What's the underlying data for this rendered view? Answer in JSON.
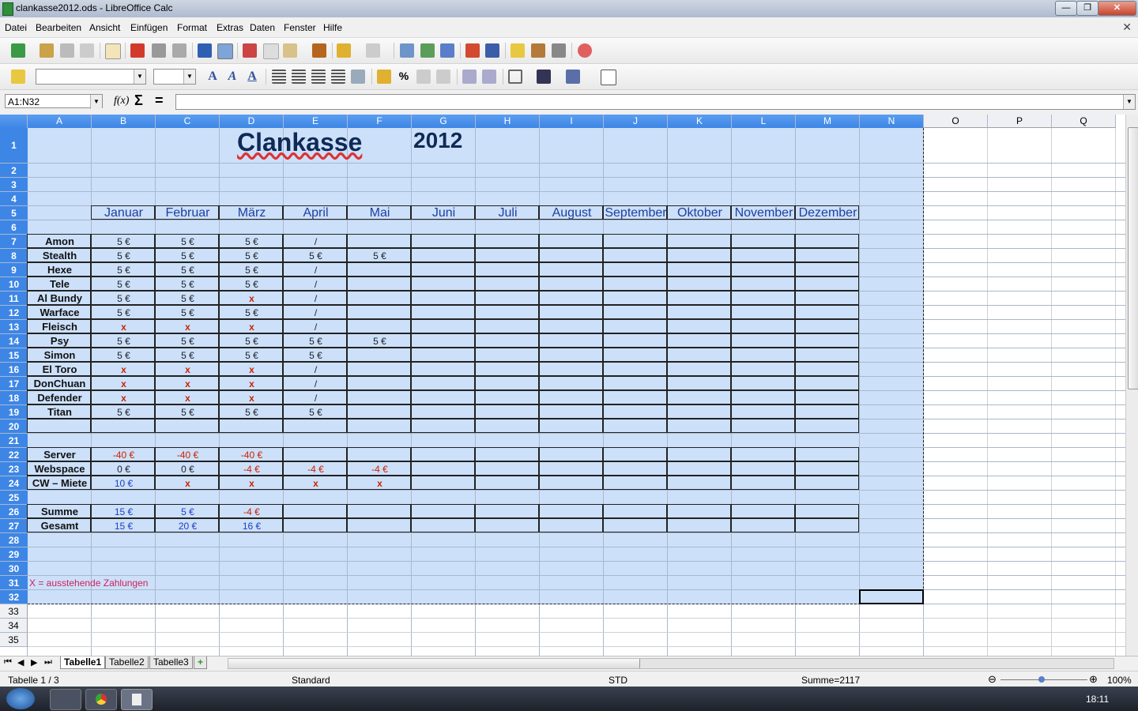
{
  "window": {
    "title": "clankasse2012.ods - LibreOffice Calc",
    "min": "—",
    "max": "❐",
    "close": "✕"
  },
  "menu": [
    "Datei",
    "Bearbeiten",
    "Ansicht",
    "Einfügen",
    "Format",
    "Extras",
    "Daten",
    "Fenster",
    "Hilfe"
  ],
  "formula": {
    "name_box": "A1:N32",
    "fx": "f(x)",
    "sum": "Σ",
    "eq": "=",
    "content": ""
  },
  "columns": [
    "A",
    "B",
    "C",
    "D",
    "E",
    "F",
    "G",
    "H",
    "I",
    "J",
    "K",
    "L",
    "M",
    "N",
    "O",
    "P",
    "Q"
  ],
  "sheet": {
    "title": "Clankasse",
    "year": "2012",
    "months": [
      "Januar",
      "Februar",
      "März",
      "April",
      "Mai",
      "Juni",
      "Juli",
      "August",
      "September",
      "Oktober",
      "November",
      "Dezember"
    ],
    "members": [
      {
        "name": "Amon",
        "vals": [
          "5 €",
          "5 €",
          "5 €",
          "/",
          ""
        ]
      },
      {
        "name": "Stealth",
        "vals": [
          "5 €",
          "5 €",
          "5 €",
          "5 €",
          "5 €"
        ]
      },
      {
        "name": "Hexe",
        "vals": [
          "5 €",
          "5 €",
          "5 €",
          "/",
          ""
        ]
      },
      {
        "name": "Tele",
        "vals": [
          "5 €",
          "5 €",
          "5 €",
          "/",
          ""
        ]
      },
      {
        "name": "Al Bundy",
        "vals": [
          "5 €",
          "5 €",
          "x",
          "/",
          ""
        ]
      },
      {
        "name": "Warface",
        "vals": [
          "5 €",
          "5 €",
          "5 €",
          "/",
          ""
        ]
      },
      {
        "name": "Fleisch",
        "vals": [
          "x",
          "x",
          "x",
          "/",
          ""
        ]
      },
      {
        "name": "Psy",
        "vals": [
          "5 €",
          "5 €",
          "5 €",
          "5 €",
          "5 €"
        ]
      },
      {
        "name": "Simon",
        "vals": [
          "5 €",
          "5 €",
          "5 €",
          "5 €",
          ""
        ]
      },
      {
        "name": "El Toro",
        "vals": [
          "x",
          "x",
          "x",
          "/",
          ""
        ]
      },
      {
        "name": "DonChuan",
        "vals": [
          "x",
          "x",
          "x",
          "/",
          ""
        ]
      },
      {
        "name": "Defender",
        "vals": [
          "x",
          "x",
          "x",
          "/",
          ""
        ]
      },
      {
        "name": "Titan",
        "vals": [
          "5 €",
          "5 €",
          "5 €",
          "5 €",
          ""
        ]
      }
    ],
    "costs": [
      {
        "name": "Server",
        "vals": [
          "-40 €",
          "-40 €",
          "-40 €",
          "",
          ""
        ]
      },
      {
        "name": "Webspace",
        "vals": [
          "0 €",
          "0 €",
          "-4 €",
          "-4 €",
          "-4 €"
        ]
      },
      {
        "name": "CW – Miete",
        "vals": [
          "10 €",
          "x",
          "x",
          "x",
          "x"
        ]
      }
    ],
    "totals": [
      {
        "name": "Summe",
        "vals": [
          "15 €",
          "5 €",
          "-4 €",
          "",
          ""
        ]
      },
      {
        "name": "Gesamt",
        "vals": [
          "15 €",
          "20 €",
          "16 €",
          "",
          ""
        ]
      }
    ],
    "legend": "X =  ausstehende Zahlungen"
  },
  "tabs": [
    "Tabelle1",
    "Tabelle2",
    "Tabelle3"
  ],
  "status": {
    "sheet": "Tabelle 1 / 3",
    "style": "Standard",
    "mode": "STD",
    "sum": "Summe=2117",
    "zoom": "100%"
  },
  "clock": "18:11",
  "colors": {
    "selection": "#cce0fa",
    "header_sel": "#3d86e6",
    "red": "#cc2200",
    "blue": "#1f3fbf"
  }
}
